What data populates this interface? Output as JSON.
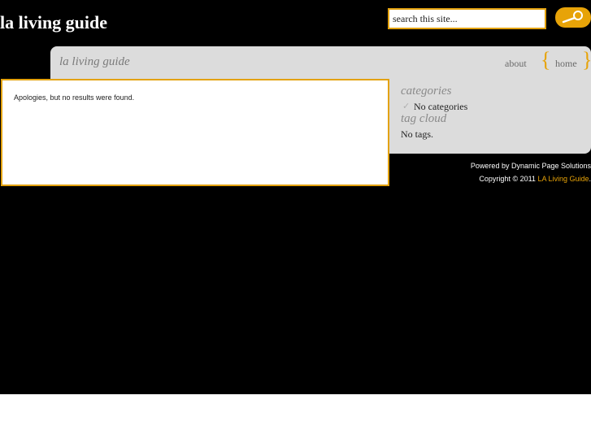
{
  "colors": {
    "accent": "#e7a308",
    "background": "#000000",
    "panel": "#dcdcdc"
  },
  "header": {
    "site_title": "la living guide",
    "search": {
      "value": "search this site...",
      "button_icon": "search-icon"
    }
  },
  "nav": {
    "panel_title": "la living guide",
    "items": [
      {
        "label": "about"
      },
      {
        "label": "home"
      }
    ],
    "braces": {
      "left": "{",
      "right": "}"
    }
  },
  "content": {
    "message": "Apologies, but no results were found."
  },
  "sidebar": {
    "categories_heading": "categories",
    "categories": [
      {
        "label": "No categories",
        "icon": "check-icon"
      }
    ],
    "tags_heading": "tag cloud",
    "tags_text": "No tags."
  },
  "footer": {
    "powered_by": "Powered by Dynamic Page Solutions",
    "copyright_prefix": "Copyright © 2011 ",
    "copyright_link": "LA Living Guide",
    "copyright_suffix": "."
  }
}
